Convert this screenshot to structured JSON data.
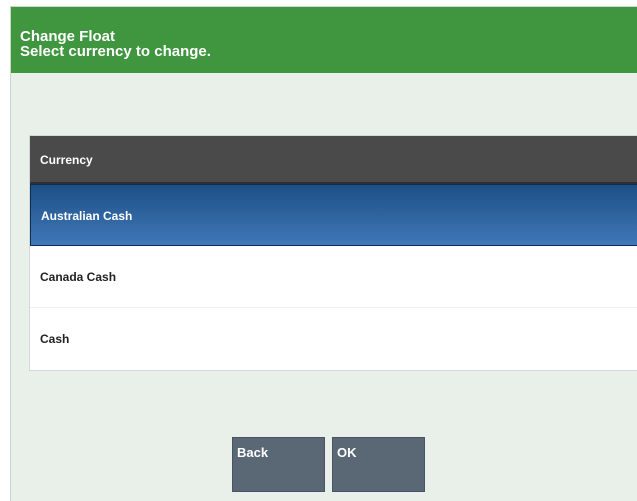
{
  "header": {
    "title": "Change Float",
    "subtitle": "Select currency to change."
  },
  "table": {
    "column_header": "Currency",
    "rows": [
      {
        "label": "Australian Cash",
        "selected": true
      },
      {
        "label": "Canada Cash",
        "selected": false
      },
      {
        "label": "Cash",
        "selected": false
      }
    ]
  },
  "buttons": {
    "back_label": "Back",
    "ok_label": "OK"
  },
  "colors": {
    "header_bg": "#3f963f",
    "selected_row": "#2b609e",
    "button_bg": "#5a6876",
    "panel_bg": "#e9f0e9"
  }
}
